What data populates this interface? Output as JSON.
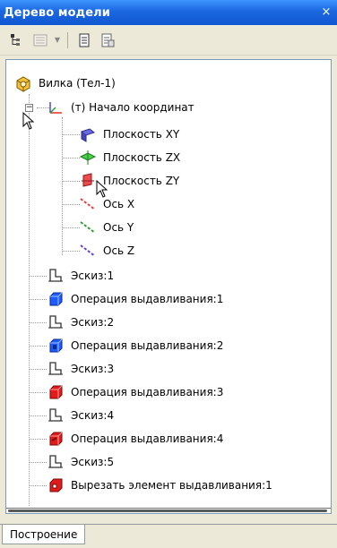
{
  "window": {
    "title": "Дерево модели",
    "close_glyph": "×"
  },
  "toolbar": {
    "buttons": [
      {
        "icon": "tree-structure-icon"
      },
      {
        "icon": "tree-options-icon"
      },
      {
        "icon": "document-icon"
      },
      {
        "icon": "document-properties-icon"
      }
    ]
  },
  "tree": {
    "root": {
      "label": "Вилка (Тел-1)",
      "icon": "part-icon"
    },
    "origin": {
      "label": "(т) Начало координат",
      "icon": "origin-axes-icon"
    },
    "origin_children": [
      {
        "label": "Плоскость XY",
        "icon": "plane-xy-icon",
        "color": "#5a5ad8"
      },
      {
        "label": "Плоскость ZX",
        "icon": "plane-zx-icon",
        "color": "#3cbf3c"
      },
      {
        "label": "Плоскость ZY",
        "icon": "plane-zy-icon",
        "color": "#e04040"
      },
      {
        "label": "Ось X",
        "icon": "axis-x-icon",
        "color": "#e04040"
      },
      {
        "label": "Ось Y",
        "icon": "axis-y-icon",
        "color": "#2ca02c"
      },
      {
        "label": "Ось Z",
        "icon": "axis-z-icon",
        "color": "#6a3fd0"
      }
    ],
    "features": [
      {
        "label": "Эскиз:1",
        "icon": "sketch-icon"
      },
      {
        "label": "Операция выдавливания:1",
        "icon": "extrude-icon",
        "color": "#1f5cff"
      },
      {
        "label": "Эскиз:2",
        "icon": "sketch-icon"
      },
      {
        "label": "Операция выдавливания:2",
        "icon": "extrude-icon",
        "color": "#1f5cff"
      },
      {
        "label": "Эскиз:3",
        "icon": "sketch-icon"
      },
      {
        "label": "Операция выдавливания:3",
        "icon": "extrude-icon",
        "color": "#e01b1b"
      },
      {
        "label": "Эскиз:4",
        "icon": "sketch-icon"
      },
      {
        "label": "Операция выдавливания:4",
        "icon": "extrude-icon",
        "color": "#e01b1b"
      },
      {
        "label": "Эскиз:5",
        "icon": "sketch-icon"
      },
      {
        "label": "Вырезать элемент выдавливания:1",
        "icon": "cut-extrude-icon",
        "color": "#e01b1b"
      }
    ]
  },
  "tabs": [
    {
      "label": "Построение"
    }
  ]
}
